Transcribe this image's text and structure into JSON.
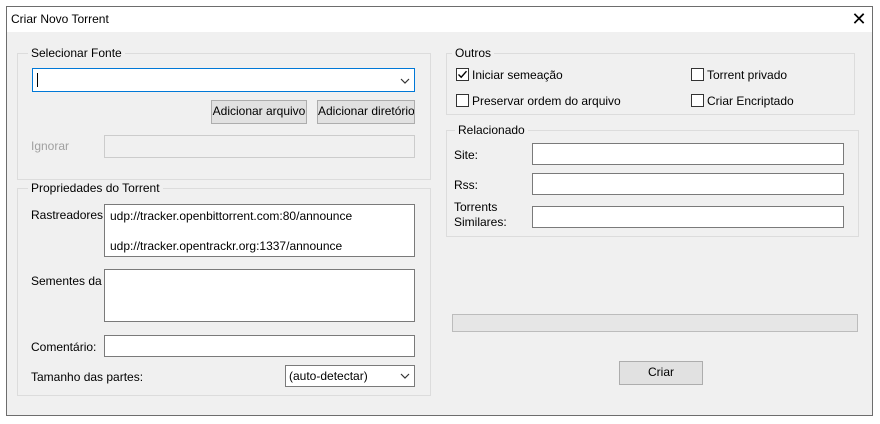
{
  "window": {
    "title": "Criar Novo Torrent"
  },
  "source": {
    "group_title": "Selecionar Fonte",
    "path_value": "",
    "add_file_label": "Adicionar arquivo",
    "add_dir_label": "Adicionar diretório",
    "ignore_label": "Ignorar",
    "ignore_value": ""
  },
  "properties": {
    "group_title": "Propriedades do Torrent",
    "trackers_label": "Rastreadores:",
    "trackers": [
      "udp://tracker.openbittorrent.com:80/announce",
      "udp://tracker.opentrackr.org:1337/announce"
    ],
    "seeds_label": "Sementes da",
    "comment_label": "Comentário:",
    "comment_value": "",
    "piece_size_label": "Tamanho das partes:",
    "piece_size_value": "(auto-detectar)"
  },
  "others": {
    "group_title": "Outros",
    "start_seeding": {
      "label": "Iniciar semeação",
      "checked": true
    },
    "private_torrent": {
      "label": "Torrent privado",
      "checked": false
    },
    "preserve_order": {
      "label": "Preservar ordem do arquivo",
      "checked": false
    },
    "encrypted": {
      "label": "Criar Encriptado",
      "checked": false
    }
  },
  "related": {
    "group_title": "Relacionado",
    "site_label": "Site:",
    "rss_label": "Rss:",
    "similar_label_line1": "Torrents",
    "similar_label_line2": "Similares:"
  },
  "progress": {
    "value": 0
  },
  "actions": {
    "create_label": "Criar"
  }
}
